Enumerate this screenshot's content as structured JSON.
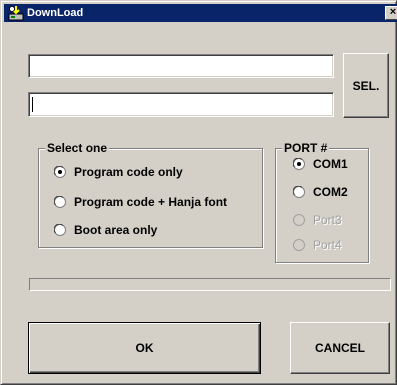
{
  "window": {
    "title": "DownLoad",
    "close_glyph": "×",
    "icon": "download-app-icon"
  },
  "file_inputs": {
    "path1_value": "",
    "path2_value": ""
  },
  "buttons": {
    "select_label": "SEL.",
    "ok_label": "OK",
    "cancel_label": "CANCEL"
  },
  "select_group": {
    "label": "Select one",
    "options": [
      {
        "label": "Program code only",
        "selected": true,
        "enabled": true
      },
      {
        "label": "Program code + Hanja font",
        "selected": false,
        "enabled": true
      },
      {
        "label": "Boot area only",
        "selected": false,
        "enabled": true
      }
    ]
  },
  "port_group": {
    "label": "PORT #",
    "options": [
      {
        "label": "COM1",
        "selected": true,
        "enabled": true
      },
      {
        "label": "COM2",
        "selected": false,
        "enabled": true
      },
      {
        "label": "Port3",
        "selected": false,
        "enabled": false
      },
      {
        "label": "Port4",
        "selected": false,
        "enabled": false
      }
    ]
  },
  "progress": {
    "fraction": 0
  },
  "colors": {
    "titlebar": "#0a246a",
    "face": "#d4d0c8",
    "disabled_text": "#a0a0a0"
  }
}
